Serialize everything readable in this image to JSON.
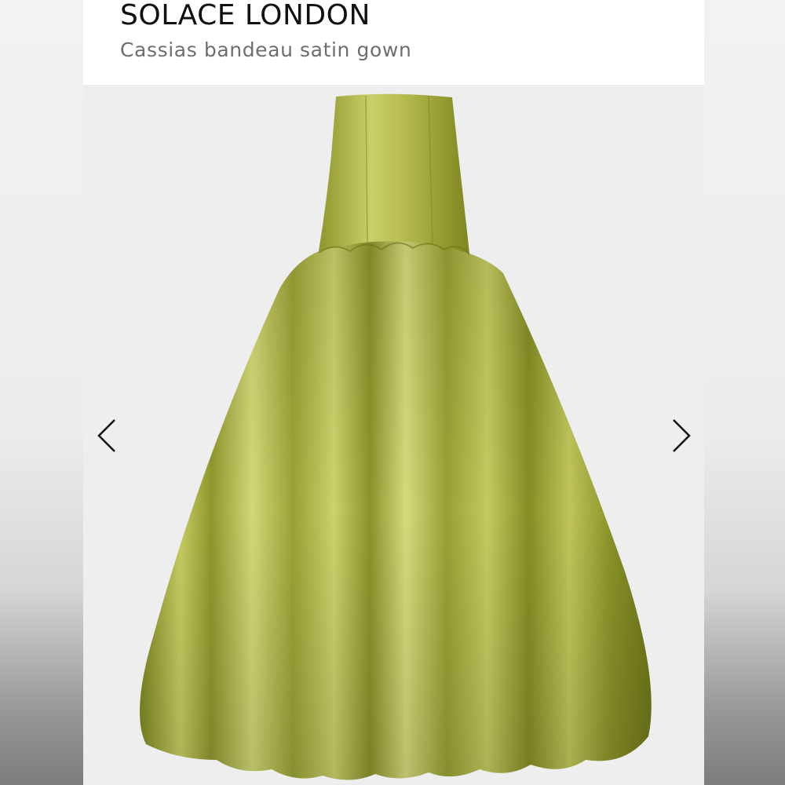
{
  "product": {
    "brand": "SOLACE LONDON",
    "name": "Cassias bandeau satin gown"
  },
  "gallery": {
    "prev_icon": "chevron-left-icon",
    "next_icon": "chevron-right-icon"
  },
  "colors": {
    "gown": "#a3ab3a",
    "gown_highlight": "#d4d97a",
    "gown_shadow": "#6f7420",
    "background": "#efefef"
  }
}
